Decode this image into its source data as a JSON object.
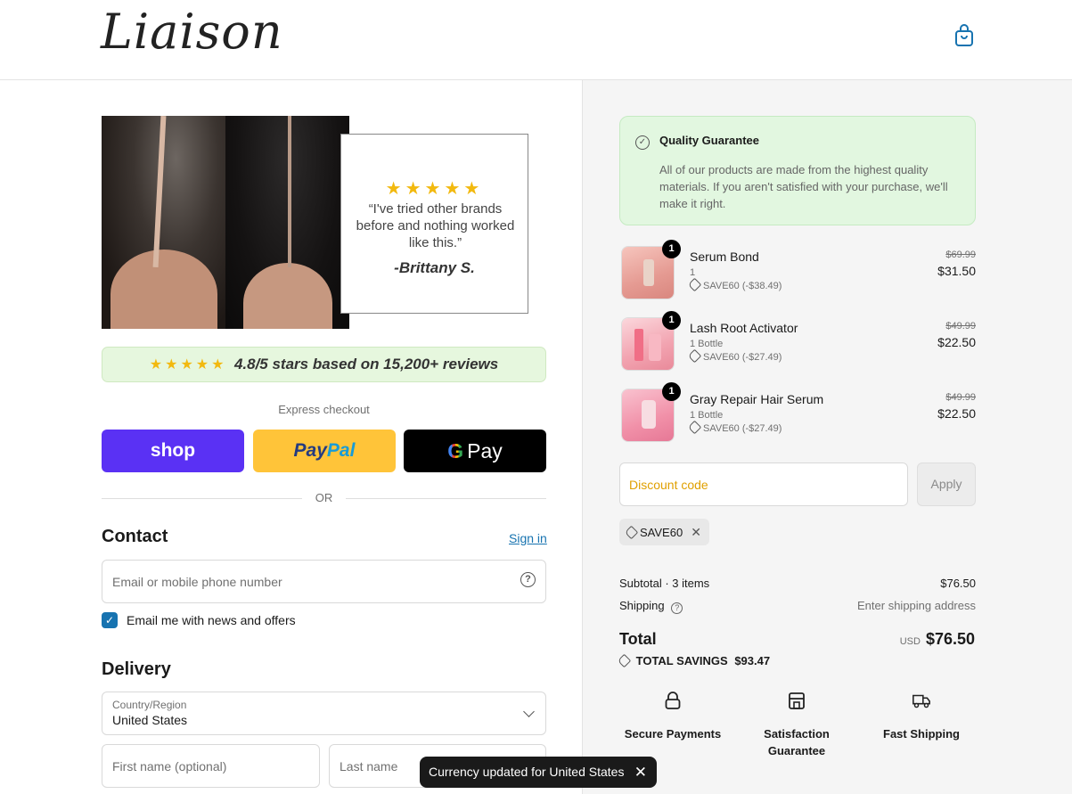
{
  "header": {
    "logo": "Liaison",
    "bag_icon": "shopping-bag-icon"
  },
  "banner": {
    "stars": "★★★★★",
    "quote": "“I've tried other brands before and nothing worked like this.”",
    "author": "-Brittany S."
  },
  "rating": {
    "stars": "★★★★★",
    "text": "4.8/5 stars based on 15,200+ reviews"
  },
  "express": {
    "label": "Express checkout",
    "shop_label": "shop",
    "paypal_label_1": "Pay",
    "paypal_label_2": "Pal",
    "gpay_g": "G",
    "gpay_label": "Pay",
    "or_label": "OR"
  },
  "contact": {
    "title": "Contact",
    "signin_label": "Sign in",
    "email_placeholder": "Email or mobile phone number",
    "news_checkbox_label": "Email me with news and offers",
    "news_checked": true
  },
  "delivery": {
    "title": "Delivery",
    "country_label": "Country/Region",
    "country_value": "United States",
    "first_name_placeholder": "First name (optional)",
    "last_name_placeholder": "Last name"
  },
  "toast": {
    "text": "Currency updated for United States"
  },
  "guarantee": {
    "title": "Quality Guarantee",
    "text": "All of our products are made from the highest quality materials. If you aren't satisfied with your purchase, we'll make it right."
  },
  "cart": {
    "items": [
      {
        "qty": "1",
        "name": "Serum Bond",
        "variant": "1",
        "discount": "SAVE60 (-$38.49)",
        "old_price": "$69.99",
        "price": "$31.50"
      },
      {
        "qty": "1",
        "name": "Lash Root Activator",
        "variant": "1 Bottle",
        "discount": "SAVE60 (-$27.49)",
        "old_price": "$49.99",
        "price": "$22.50"
      },
      {
        "qty": "1",
        "name": "Gray Repair Hair Serum",
        "variant": "1 Bottle",
        "discount": "SAVE60 (-$27.49)",
        "old_price": "$49.99",
        "price": "$22.50"
      }
    ]
  },
  "discount": {
    "placeholder": "Discount code",
    "apply_label": "Apply",
    "applied_code": "SAVE60"
  },
  "summary": {
    "subtotal_label": "Subtotal · 3 items",
    "subtotal_value": "$76.50",
    "shipping_label": "Shipping",
    "shipping_value": "Enter shipping address",
    "total_label": "Total",
    "currency": "USD",
    "total_value": "$76.50",
    "savings_label": "TOTAL SAVINGS",
    "savings_value": "$93.47"
  },
  "badges": [
    {
      "icon": "lock-icon",
      "label": "Secure Payments"
    },
    {
      "icon": "store-icon",
      "label": "Satisfaction Guarantee"
    },
    {
      "icon": "truck-icon",
      "label": "Fast Shipping"
    }
  ],
  "colors": {
    "shop_purple": "#5a31f4",
    "paypal_yellow": "#ffc439",
    "link_blue": "#1773b0",
    "guarantee_green": "#e2f7e0",
    "star_gold": "#f2b90f"
  }
}
